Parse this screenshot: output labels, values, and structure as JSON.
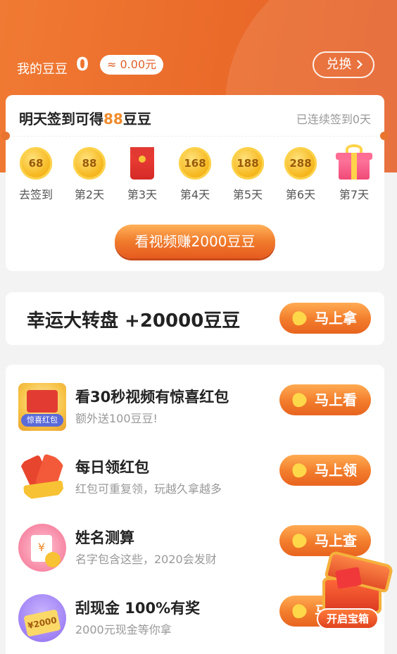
{
  "header": {
    "beans_label": "我的豆豆",
    "beans_count": "0",
    "money": "≈ 0.00元",
    "exchange_label": "兑换"
  },
  "signin": {
    "title_prefix": "明天签到可得",
    "title_amount": "88",
    "title_suffix": "豆豆",
    "streak": "已连续签到0天",
    "days": [
      {
        "reward": "68",
        "label": "去签到",
        "icon": "coin-icon"
      },
      {
        "reward": "88",
        "label": "第2天",
        "icon": "coin-icon"
      },
      {
        "reward": "",
        "label": "第3天",
        "icon": "red-packet-icon"
      },
      {
        "reward": "168",
        "label": "第4天",
        "icon": "coin-icon"
      },
      {
        "reward": "188",
        "label": "第5天",
        "icon": "coin-icon"
      },
      {
        "reward": "288",
        "label": "第6天",
        "icon": "coin-icon"
      },
      {
        "reward": "",
        "label": "第7天",
        "icon": "gift-box-icon"
      }
    ],
    "video_button": "看视频赚2000豆豆"
  },
  "wheel": {
    "title": "幸运大转盘 +20000豆豆",
    "button": "马上拿"
  },
  "tasks": [
    {
      "title": "看30秒视频有惊喜红包",
      "subtitle": "额外送100豆豆!",
      "button": "马上看",
      "icon_tag": "惊喜红包",
      "icon": "surprise-red-packet-icon"
    },
    {
      "title": "每日领红包",
      "subtitle": "红包可重复领，玩越久拿越多",
      "button": "马上领",
      "icon": "red-packets-gold-icon"
    },
    {
      "title": "姓名测算",
      "subtitle": "名字包含这些，2020会发财",
      "button": "马上查",
      "icon": "name-fortune-icon",
      "icon_text": "¥"
    },
    {
      "title": "刮现金 100%有奖",
      "subtitle": "2000元现金等你拿",
      "button": "马上刮",
      "icon": "scratch-card-icon",
      "icon_text": "¥2000"
    }
  ],
  "treasure": {
    "label": "开启宝箱",
    "icon": "treasure-chest-icon"
  },
  "colors": {
    "brand_orange": "#ea6a2a",
    "accent_gold": "#f08a2a"
  }
}
